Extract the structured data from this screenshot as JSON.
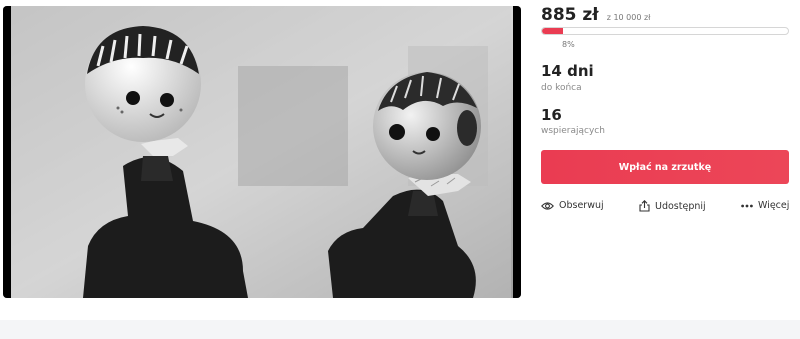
{
  "campaign": {
    "amount": "885 zł",
    "goal": "z 10 000 zł",
    "progress_fraction": 0.085,
    "percent_label": "8%",
    "days_value": "14 dni",
    "days_label": "do końca",
    "supporters_value": "16",
    "supporters_label": "wspierających"
  },
  "donate_button": {
    "label": "Wpłać na zrzutkę"
  },
  "actions": {
    "follow": {
      "label": "Obserwuj",
      "icon": "eye-icon"
    },
    "share": {
      "label": "Udostępnij",
      "icon": "share-icon"
    },
    "more": {
      "label": "Więcej",
      "icon": "more-dots-icon"
    }
  },
  "colors": {
    "accent": "#ea3c52"
  }
}
